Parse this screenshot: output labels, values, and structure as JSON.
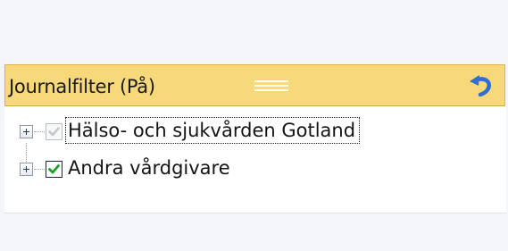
{
  "panel": {
    "title": "Journalfilter (På)",
    "grip_icon": "drag-handle-icon",
    "reset_icon": "undo-arrow-icon",
    "header_color": "#f8d97a"
  },
  "tree": {
    "items": [
      {
        "label": "Hälso- och sjukvården Gotland",
        "checked": true,
        "disabled": true,
        "expanded": false,
        "focused": true
      },
      {
        "label": "Andra vårdgivare",
        "checked": true,
        "disabled": false,
        "expanded": false,
        "focused": false
      }
    ]
  }
}
